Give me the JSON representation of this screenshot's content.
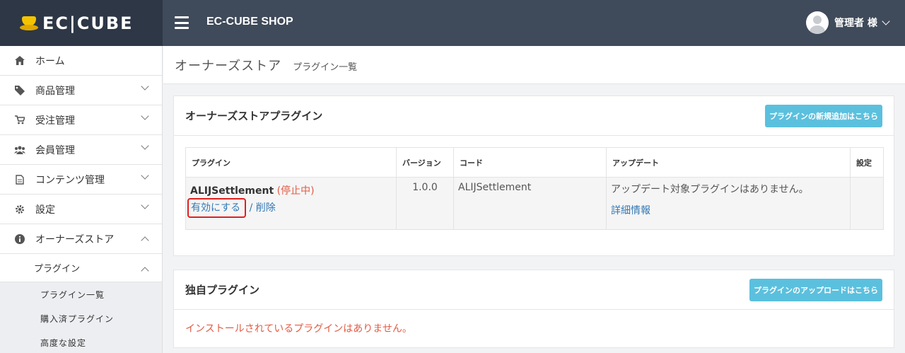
{
  "header": {
    "brand": "EC|CUBE",
    "shop_name": "EC-CUBE SHOP",
    "user": "管理者 様"
  },
  "sidebar": {
    "items": [
      {
        "label": "ホーム",
        "icon": "home-icon"
      },
      {
        "label": "商品管理",
        "icon": "tag-icon"
      },
      {
        "label": "受注管理",
        "icon": "cart-icon"
      },
      {
        "label": "会員管理",
        "icon": "users-icon"
      },
      {
        "label": "コンテンツ管理",
        "icon": "file-icon"
      },
      {
        "label": "設定",
        "icon": "gear-icon"
      },
      {
        "label": "オーナーズストア",
        "icon": "info-icon"
      }
    ],
    "sub": {
      "label": "プラグイン"
    },
    "leaves": [
      {
        "label": "プラグイン一覧"
      },
      {
        "label": "購入済プラグイン"
      },
      {
        "label": "高度な設定"
      }
    ]
  },
  "page": {
    "title": "オーナーズストア",
    "subtitle": "プラグイン一覧"
  },
  "store_card": {
    "title": "オーナーズストアプラグイン",
    "add_button": "プラグインの新規追加はこちら",
    "columns": [
      "プラグイン",
      "バージョン",
      "コード",
      "アップデート",
      "設定"
    ],
    "row": {
      "name": "ALIJSettlement",
      "status": "(停止中)",
      "enable": "有効にする",
      "separator": "/",
      "delete": "削除",
      "version": "1.0.0",
      "code": "ALIJSettlement",
      "update_msg": "アップデート対象プラグインはありません。",
      "detail": "詳細情報",
      "settings": ""
    }
  },
  "custom_card": {
    "title": "独自プラグイン",
    "upload_button": "プラグインのアップロードはこちら",
    "empty_msg": "インストールされているプラグインはありません。"
  }
}
